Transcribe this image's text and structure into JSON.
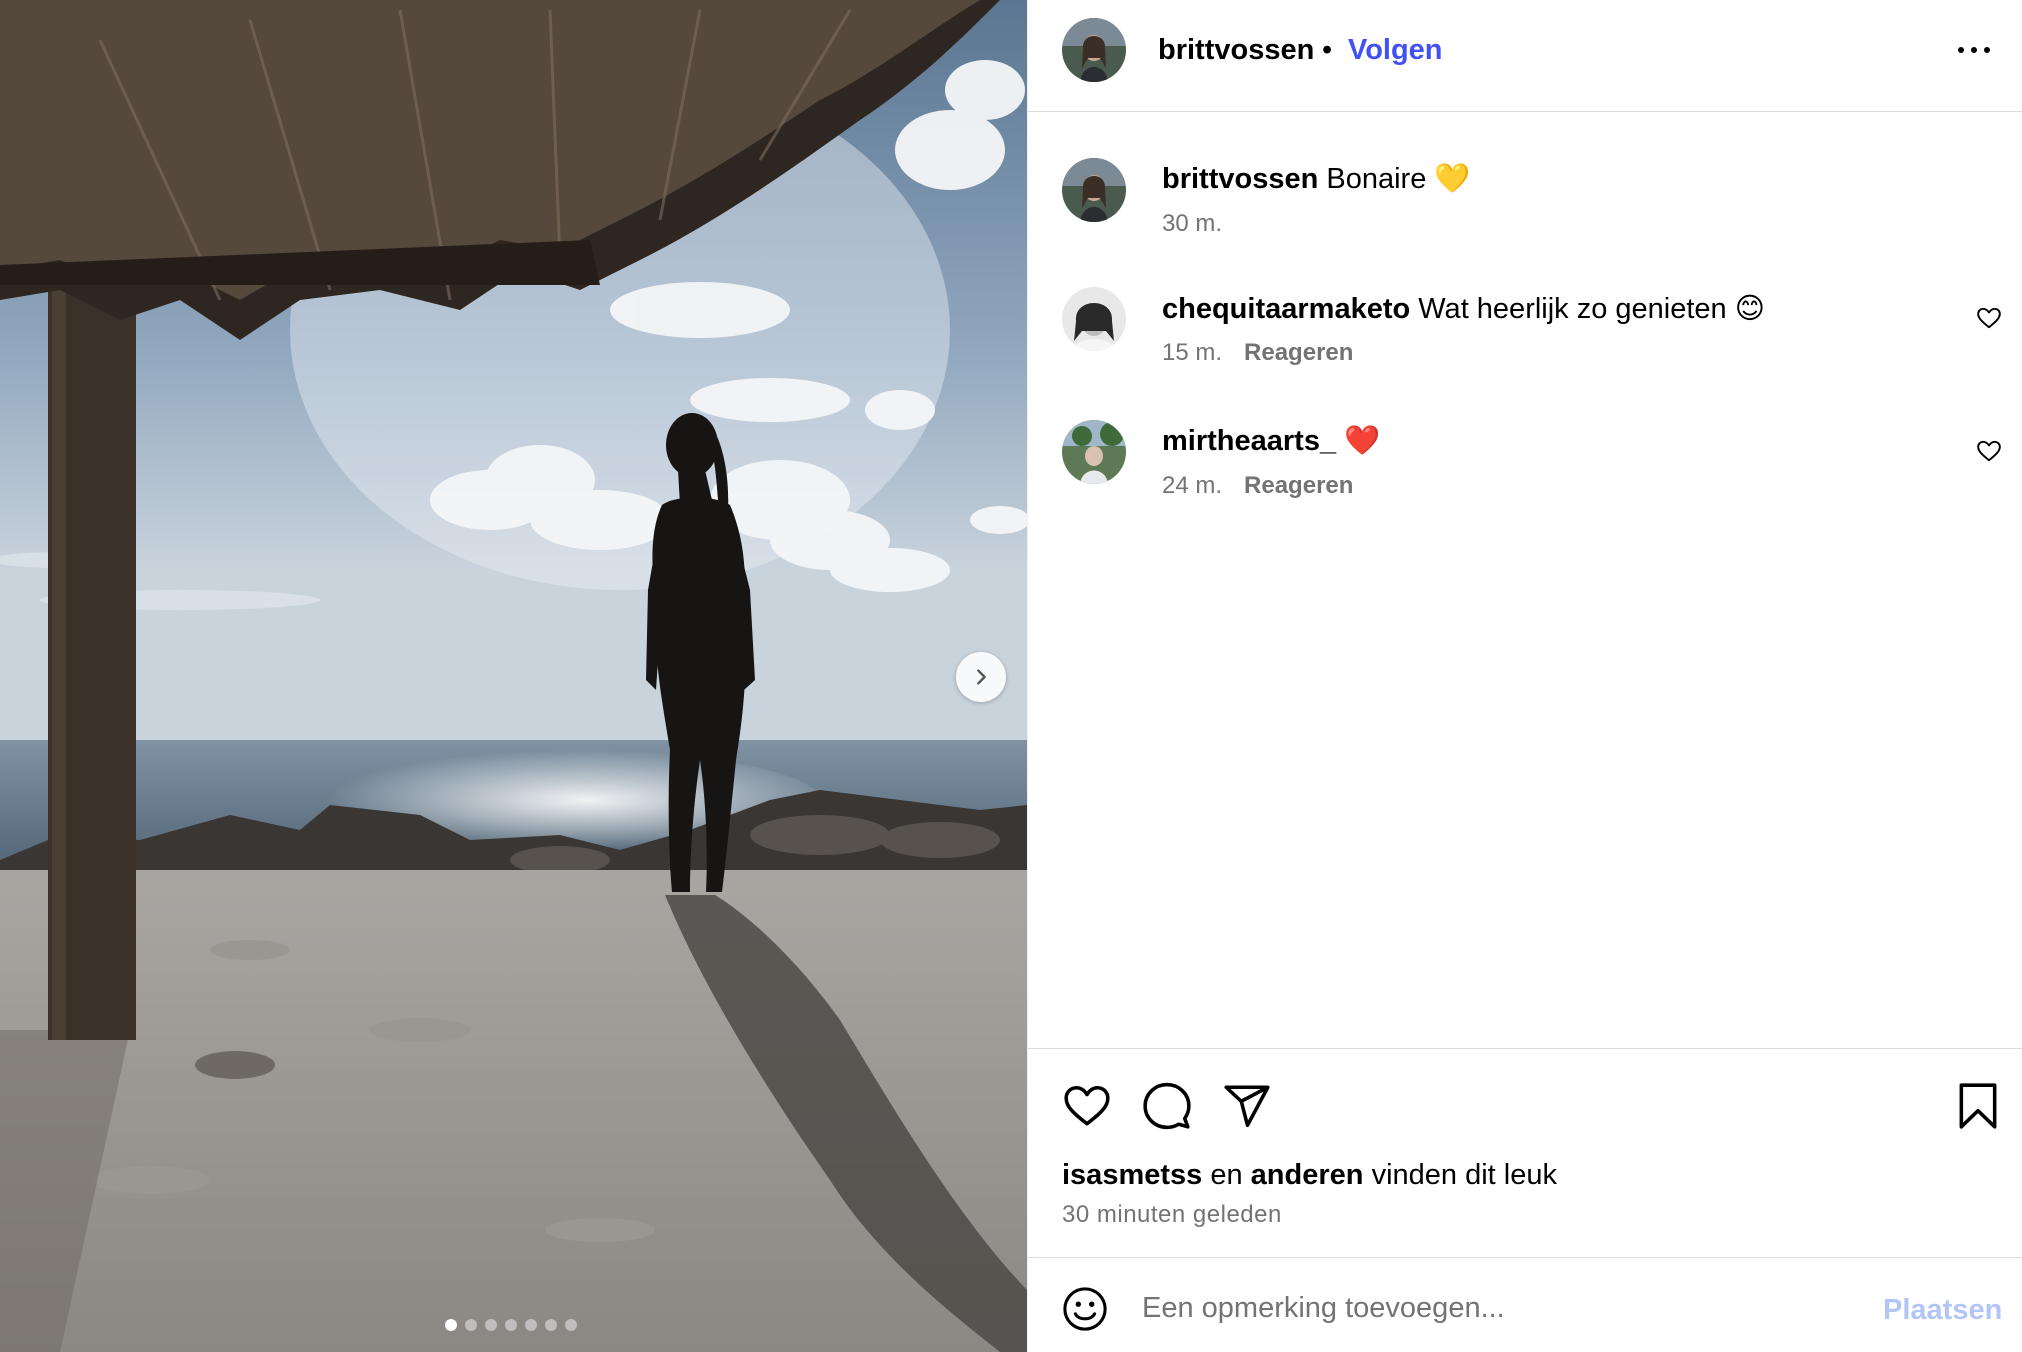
{
  "post": {
    "author": "brittvossen",
    "separator": "•",
    "follow_label": "Volgen",
    "more_icon": "more-horizontal-icon",
    "media": {
      "slide_count": 7,
      "active_slide": 1,
      "next_icon": "chevron-right-icon"
    }
  },
  "caption": {
    "username": "brittvossen",
    "text": "Bonaire 💛",
    "time": "30 m."
  },
  "comments": [
    {
      "username": "chequitaarmaketo",
      "text": "Wat heerlijk zo genieten 😊",
      "time": "15 m.",
      "reply_label": "Reageren",
      "icon": "heart-outline-icon"
    },
    {
      "username": "mirtheaarts_",
      "text": "❤️",
      "time": "24 m.",
      "reply_label": "Reageren",
      "icon": "heart-outline-icon"
    }
  ],
  "actions": {
    "like_icon": "heart-outline-icon",
    "comment_icon": "comment-bubble-icon",
    "share_icon": "paper-plane-icon",
    "save_icon": "bookmark-icon"
  },
  "likes": {
    "user": "isasmetss",
    "conjunction": "en",
    "others": "anderen",
    "suffix": "vinden dit leuk",
    "time": "30 minuten geleden"
  },
  "composer": {
    "emoji_icon": "smiley-icon",
    "placeholder": "Een opmerking toevoegen...",
    "post_label": "Plaatsen"
  },
  "colors": {
    "follow": "#4150f7",
    "post_disabled": "#b3c5f7",
    "secondary_text": "#737373",
    "divider": "#dbdbdb"
  }
}
